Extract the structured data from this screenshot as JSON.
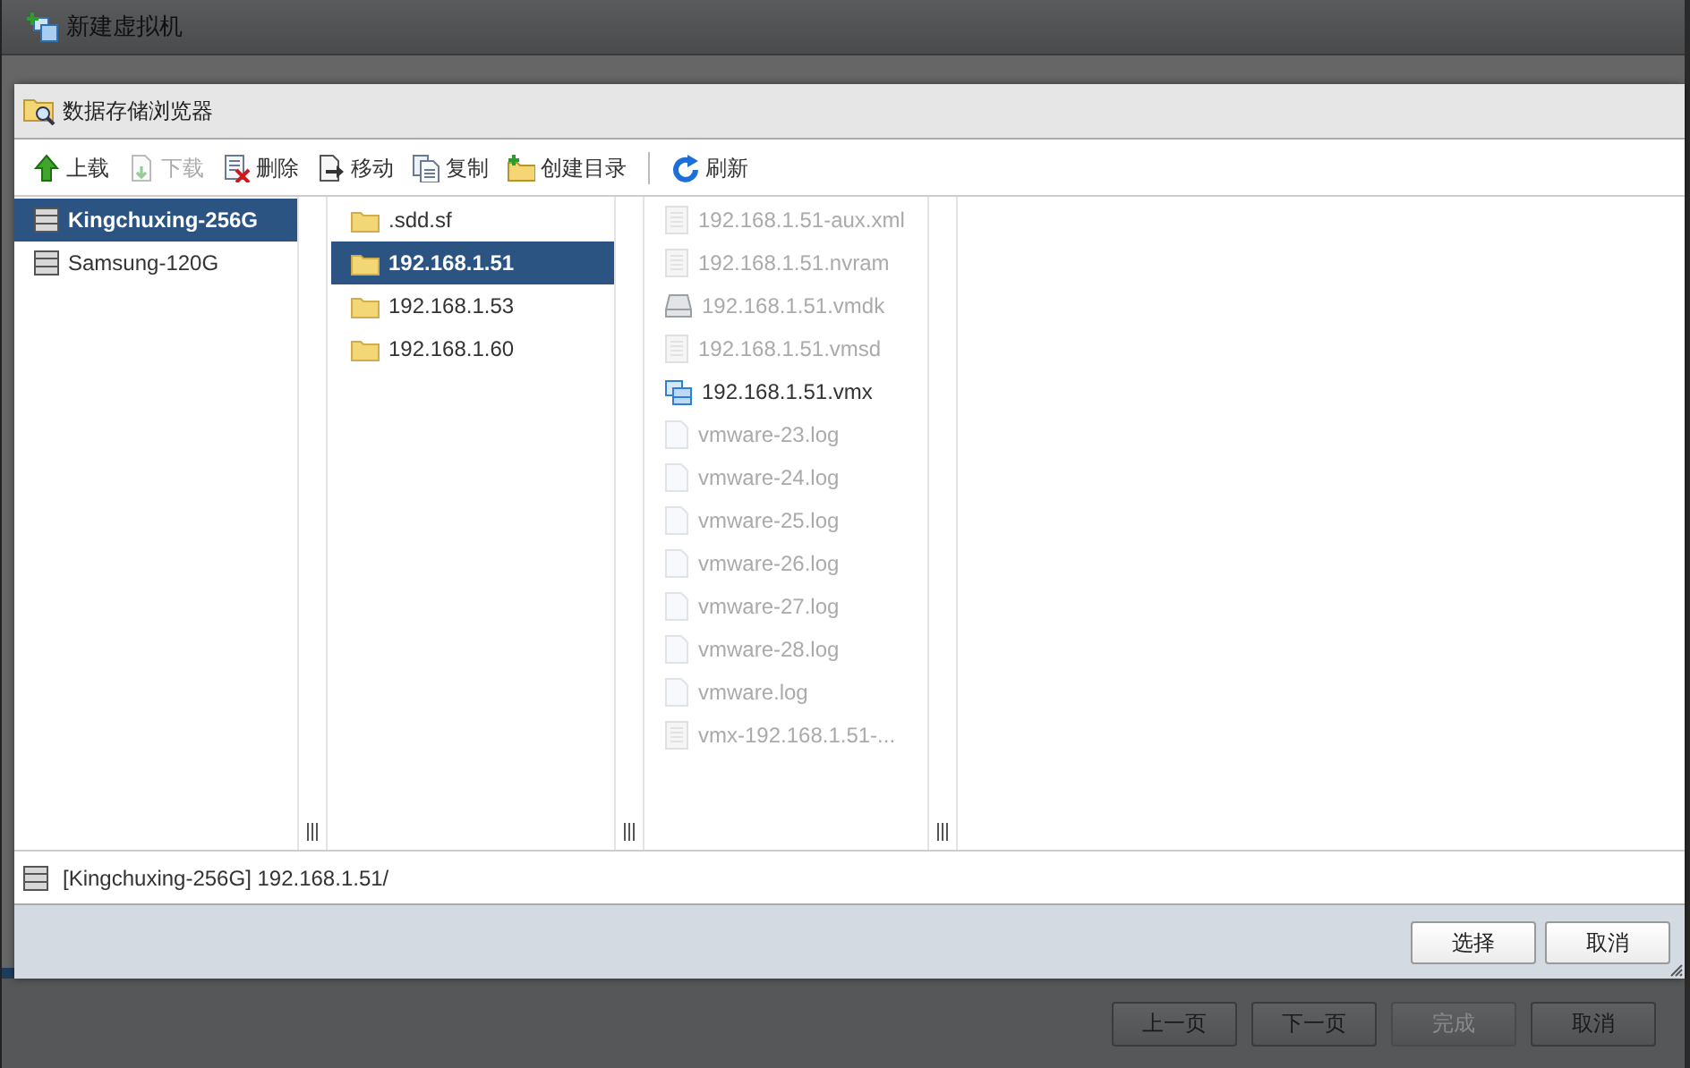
{
  "wizard": {
    "title": "新建虚拟机",
    "footer_buttons": [
      {
        "label": "上一页",
        "disabled": false
      },
      {
        "label": "下一页",
        "disabled": false
      },
      {
        "label": "完成",
        "disabled": true
      },
      {
        "label": "取消",
        "disabled": false
      }
    ]
  },
  "dialog": {
    "title": "数据存储浏览器",
    "toolbar_groups": [
      [
        {
          "label": "上载",
          "kind": "upload",
          "disabled": false
        },
        {
          "label": "下载",
          "kind": "download",
          "disabled": true
        },
        {
          "label": "删除",
          "kind": "delete",
          "disabled": false
        },
        {
          "label": "移动",
          "kind": "move",
          "disabled": false
        },
        {
          "label": "复制",
          "kind": "copy",
          "disabled": false
        },
        {
          "label": "创建目录",
          "kind": "new-folder",
          "disabled": false
        }
      ],
      [
        {
          "label": "刷新",
          "kind": "refresh",
          "disabled": false
        }
      ]
    ],
    "datastores": [
      {
        "label": "Kingchuxing-256G",
        "selected": true
      },
      {
        "label": "Samsung-120G",
        "selected": false
      }
    ],
    "folders": [
      {
        "label": ".sdd.sf",
        "selected": false
      },
      {
        "label": "192.168.1.51",
        "selected": true
      },
      {
        "label": "192.168.1.53",
        "selected": false
      },
      {
        "label": "192.168.1.60",
        "selected": false
      }
    ],
    "files": [
      {
        "label": "192.168.1.51-aux.xml",
        "kind": "document",
        "disabled": true
      },
      {
        "label": "192.168.1.51.nvram",
        "kind": "document",
        "disabled": true
      },
      {
        "label": "192.168.1.51.vmdk",
        "kind": "disk",
        "disabled": true
      },
      {
        "label": "192.168.1.51.vmsd",
        "kind": "document",
        "disabled": true
      },
      {
        "label": "192.168.1.51.vmx",
        "kind": "vm",
        "disabled": false
      },
      {
        "label": "vmware-23.log",
        "kind": "log",
        "disabled": true
      },
      {
        "label": "vmware-24.log",
        "kind": "log",
        "disabled": true
      },
      {
        "label": "vmware-25.log",
        "kind": "log",
        "disabled": true
      },
      {
        "label": "vmware-26.log",
        "kind": "log",
        "disabled": true
      },
      {
        "label": "vmware-27.log",
        "kind": "log",
        "disabled": true
      },
      {
        "label": "vmware-28.log",
        "kind": "log",
        "disabled": true
      },
      {
        "label": "vmware.log",
        "kind": "log",
        "disabled": true
      },
      {
        "label": "vmx-192.168.1.51-...",
        "kind": "document",
        "disabled": true
      }
    ],
    "path": "[Kingchuxing-256G] 192.168.1.51/",
    "buttons": [
      {
        "label": "选择"
      },
      {
        "label": "取消"
      }
    ]
  }
}
